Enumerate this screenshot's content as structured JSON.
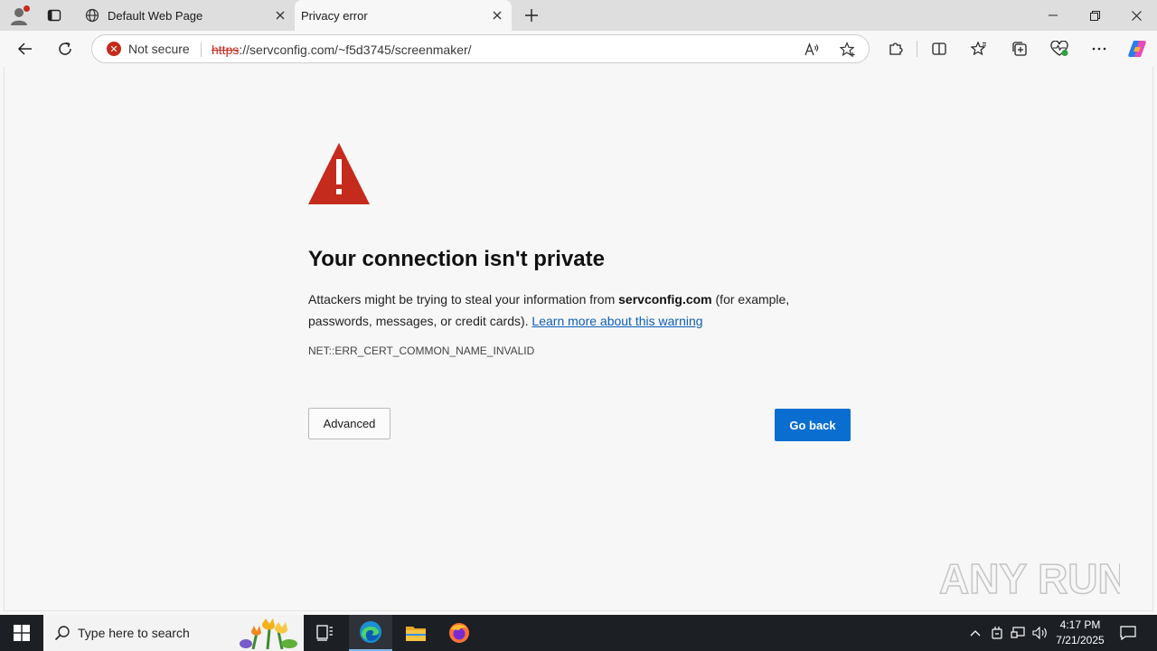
{
  "browser": {
    "tabs": [
      {
        "title": "Default Web Page",
        "active": false
      },
      {
        "title": "Privacy error",
        "active": true
      }
    ]
  },
  "toolbar": {
    "security_label": "Not secure",
    "url_scheme": "https",
    "url_rest": "://servconfig.com/~f5d3745/screenmaker/"
  },
  "page": {
    "heading": "Your connection isn't private",
    "text_before": "Attackers might be trying to steal your information from ",
    "host": "servconfig.com",
    "text_after": " (for example, passwords, messages, or credit cards). ",
    "learn_more": "Learn more about this warning",
    "error_code": "NET::ERR_CERT_COMMON_NAME_INVALID",
    "advanced_label": "Advanced",
    "go_back_label": "Go back",
    "warning_color": "#c42b1c",
    "primary_color": "#0a6ed1"
  },
  "watermark": {
    "text": "ANY RUN"
  },
  "taskbar": {
    "search_placeholder": "Type here to search",
    "time": "4:17 PM",
    "date": "7/21/2025"
  }
}
